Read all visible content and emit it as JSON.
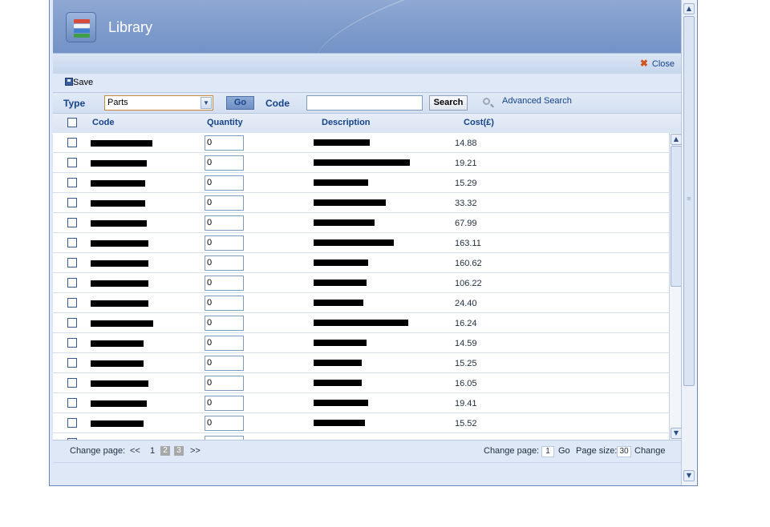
{
  "dialog": {
    "title": "Library",
    "close_label": "Close",
    "save_label": "Save"
  },
  "filter": {
    "type_label": "Type",
    "type_value": "Parts",
    "go_label": "Go",
    "code_label": "Code",
    "code_value": "",
    "search_label": "Search",
    "advanced_label": "Advanced Search"
  },
  "grid": {
    "columns": [
      "Code",
      "Quantity",
      "Description",
      "Cost(£)"
    ],
    "rows": [
      {
        "quantity": "0",
        "cost": "14.88"
      },
      {
        "quantity": "0",
        "cost": "19.21"
      },
      {
        "quantity": "0",
        "cost": "15.29"
      },
      {
        "quantity": "0",
        "cost": "33.32"
      },
      {
        "quantity": "0",
        "cost": "67.99"
      },
      {
        "quantity": "0",
        "cost": "163.11"
      },
      {
        "quantity": "0",
        "cost": "160.62"
      },
      {
        "quantity": "0",
        "cost": "106.22"
      },
      {
        "quantity": "0",
        "cost": "24.40"
      },
      {
        "quantity": "0",
        "cost": "16.24"
      },
      {
        "quantity": "0",
        "cost": "14.59"
      },
      {
        "quantity": "0",
        "cost": "15.25"
      },
      {
        "quantity": "0",
        "cost": "16.05"
      },
      {
        "quantity": "0",
        "cost": "19.41"
      },
      {
        "quantity": "0",
        "cost": "15.52"
      }
    ]
  },
  "pager": {
    "change_page_label": "Change page:",
    "first": "<<",
    "pages": [
      "1",
      "2",
      "3"
    ],
    "last": ">>",
    "change_page_label_right": "Change page:",
    "page_input": "1",
    "go_label": "Go",
    "page_size_label": "Page size:",
    "page_size_value": "30",
    "change_label": "Change"
  },
  "colors": {
    "header": "#7e9bcb",
    "accent": "#15428b",
    "panel": "#dfe8f6"
  }
}
